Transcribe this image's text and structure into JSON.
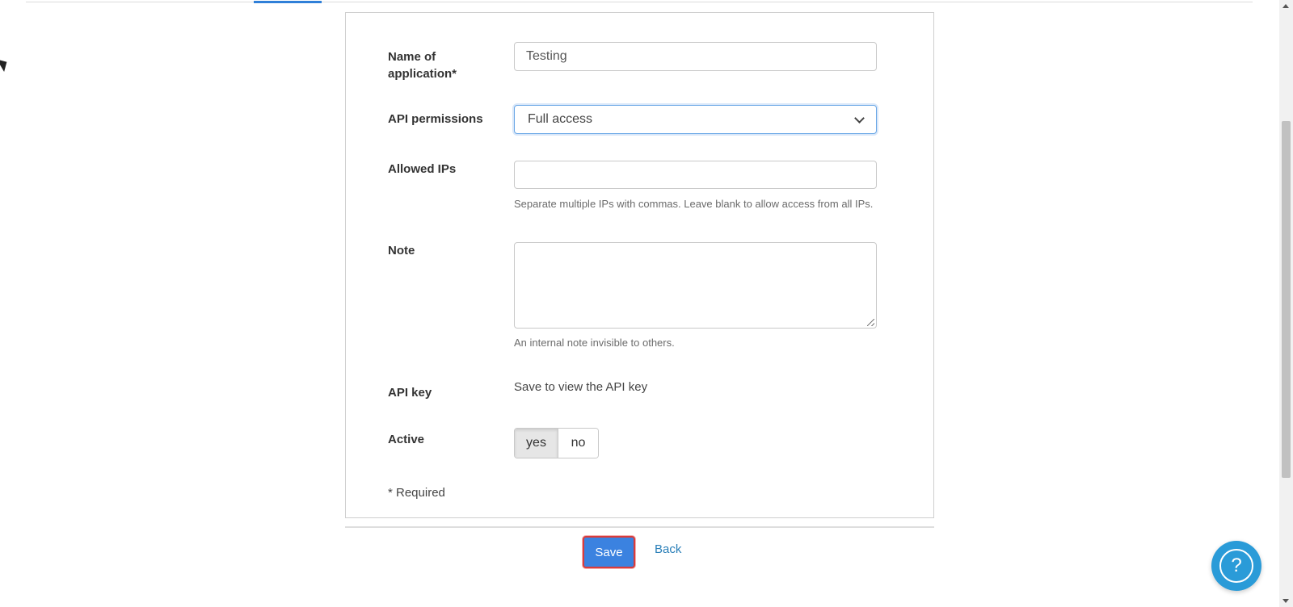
{
  "form": {
    "name": {
      "label": "Name of application*",
      "value": "Testing"
    },
    "permissions": {
      "label": "API permissions",
      "selected": "Full access"
    },
    "allowed_ips": {
      "label": "Allowed IPs",
      "value": "",
      "help": "Separate multiple IPs with commas. Leave blank to allow access from all IPs."
    },
    "note": {
      "label": "Note",
      "value": "",
      "help": "An internal note invisible to others."
    },
    "api_key": {
      "label": "API key",
      "value": "Save to view the API key"
    },
    "active": {
      "label": "Active",
      "options": [
        "yes",
        "no"
      ],
      "selected": "yes"
    },
    "required_note": "* Required"
  },
  "actions": {
    "save_label": "Save",
    "back_label": "Back"
  },
  "help_fab": {
    "label": "?"
  },
  "colors": {
    "primary": "#3b82e0",
    "link": "#2a7fb8",
    "help_fab": "#2a9bd8",
    "focus_outline": "#d93c3c"
  }
}
